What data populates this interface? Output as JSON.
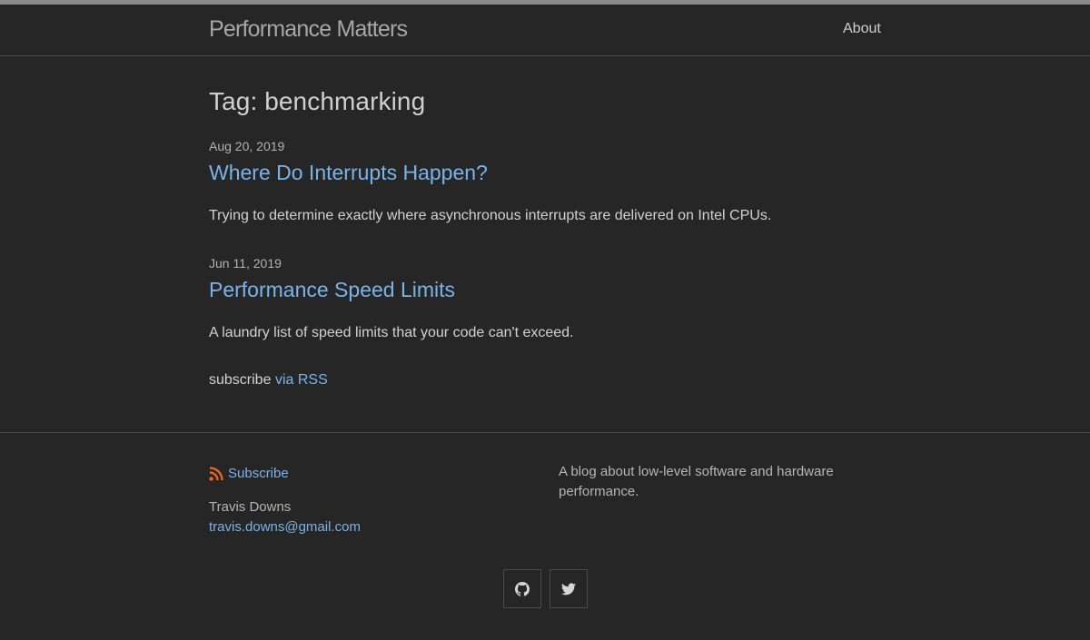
{
  "header": {
    "site_title": "Performance Matters",
    "nav": [
      {
        "label": "About"
      }
    ]
  },
  "page": {
    "heading": "Tag: benchmarking"
  },
  "posts": [
    {
      "date": "Aug 20, 2019",
      "title": "Where Do Interrupts Happen?",
      "excerpt": "Trying to determine exactly where asynchronous interrupts are delivered on Intel CPUs."
    },
    {
      "date": "Jun 11, 2019",
      "title": "Performance Speed Limits",
      "excerpt": "A laundry list of speed limits that your code can't exceed."
    }
  ],
  "subscribe": {
    "prefix": "subscribe",
    "link_label": "via RSS"
  },
  "footer": {
    "subscribe_label": "Subscribe",
    "author": "Travis Downs",
    "email": "travis.downs@gmail.com",
    "description": "A blog about low-level software and hardware performance.",
    "social": [
      {
        "icon": "github-icon"
      },
      {
        "icon": "twitter-icon"
      }
    ]
  },
  "colors": {
    "background": "#262626",
    "link": "#7ab3ea",
    "rss_orange": "#f26522",
    "top_strip": "#8a8a8a"
  }
}
